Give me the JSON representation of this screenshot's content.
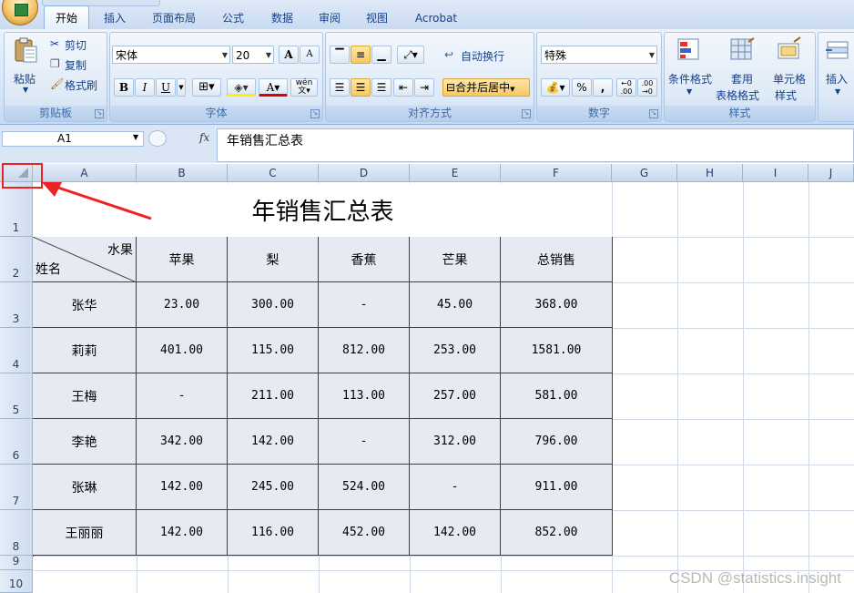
{
  "ribbon": {
    "tabs": [
      "开始",
      "插入",
      "页面布局",
      "公式",
      "数据",
      "审阅",
      "视图",
      "Acrobat"
    ],
    "clipboard": {
      "paste": "粘贴",
      "cut": "剪切",
      "copy": "复制",
      "format_painter": "格式刷",
      "title": "剪贴板"
    },
    "font": {
      "name": "宋体",
      "size": "20",
      "bold": "B",
      "italic": "I",
      "underline": "U",
      "grow": "A",
      "shrink": "A",
      "phonetic": "wén",
      "title": "字体"
    },
    "alignment": {
      "wrap": "自动换行",
      "merge": "合并后居中",
      "title": "对齐方式"
    },
    "number": {
      "format": "特殊",
      "percent": "%",
      "comma": ",",
      "title": "数字"
    },
    "styles": {
      "conditional": "条件格式",
      "table_format": [
        "套用",
        "表格格式"
      ],
      "cell_style": [
        "单元格",
        "样式"
      ],
      "title": "样式"
    },
    "cells": {
      "insert": "插入"
    }
  },
  "formula_bar": {
    "name_box": "A1",
    "fx": "fx",
    "content": "年销售汇总表"
  },
  "columns": [
    "A",
    "B",
    "C",
    "D",
    "E",
    "F",
    "G",
    "H",
    "I",
    "J"
  ],
  "rows": [
    "1",
    "2",
    "3",
    "4",
    "5",
    "6",
    "7",
    "8",
    "9",
    "10"
  ],
  "sheet": {
    "title": "年销售汇总表",
    "diag_top": "水果",
    "diag_bottom": "姓名",
    "headers": [
      "苹果",
      "梨",
      "香蕉",
      "芒果",
      "总销售"
    ],
    "records": [
      {
        "name": "张华",
        "values": [
          "23.00",
          "300.00",
          "-",
          "45.00",
          "368.00"
        ]
      },
      {
        "name": "莉莉",
        "values": [
          "401.00",
          "115.00",
          "812.00",
          "253.00",
          "1581.00"
        ]
      },
      {
        "name": "王梅",
        "values": [
          "-",
          "211.00",
          "113.00",
          "257.00",
          "581.00"
        ]
      },
      {
        "name": "李艳",
        "values": [
          "342.00",
          "142.00",
          "-",
          "312.00",
          "796.00"
        ]
      },
      {
        "name": "张琳",
        "values": [
          "142.00",
          "245.00",
          "524.00",
          "-",
          "911.00"
        ]
      },
      {
        "name": "王丽丽",
        "values": [
          "142.00",
          "116.00",
          "452.00",
          "142.00",
          "852.00"
        ]
      }
    ]
  },
  "watermark": "CSDN @statistics.insight",
  "colors": {
    "highlight": "#ee2222",
    "cell_fill": "#e6eaf3",
    "ribbon_text": "#15428b"
  }
}
